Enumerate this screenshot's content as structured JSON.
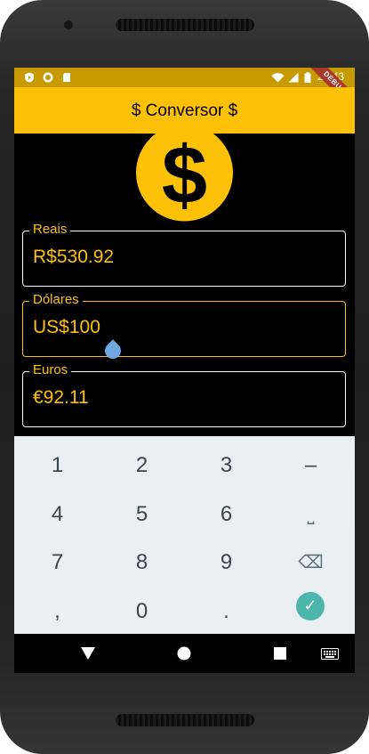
{
  "status_bar": {
    "time": "20:43",
    "left_icons": [
      "play-protect-icon",
      "record-icon",
      "sd-card-icon"
    ],
    "right_icons": [
      "wifi-icon",
      "signal-icon",
      "battery-icon"
    ],
    "debug_banner": "DEBUG"
  },
  "app_bar": {
    "title": "$ Conversor $"
  },
  "logo": {
    "icon": "dollar-coin-icon",
    "symbol": "$"
  },
  "fields": [
    {
      "label": "Reais",
      "value": "R$530.92",
      "focused": false
    },
    {
      "label": "Dólares",
      "value": "US$100",
      "focused": true
    },
    {
      "label": "Euros",
      "value": "€92.11",
      "focused": false
    }
  ],
  "keyboard": {
    "rows": [
      [
        "1",
        "2",
        "3",
        "–"
      ],
      [
        "4",
        "5",
        "6",
        "⎵"
      ],
      [
        "7",
        "8",
        "9",
        "⌫"
      ],
      [
        ",",
        "0",
        ".",
        "✓"
      ]
    ]
  },
  "nav_bar": {
    "buttons": [
      "back-icon",
      "home-icon",
      "recents-icon",
      "keyboard-switch-icon"
    ]
  },
  "colors": {
    "accent": "#ffc107",
    "background": "#000000",
    "keyboard": "#eceff1",
    "ok_key": "#4db6ac"
  }
}
